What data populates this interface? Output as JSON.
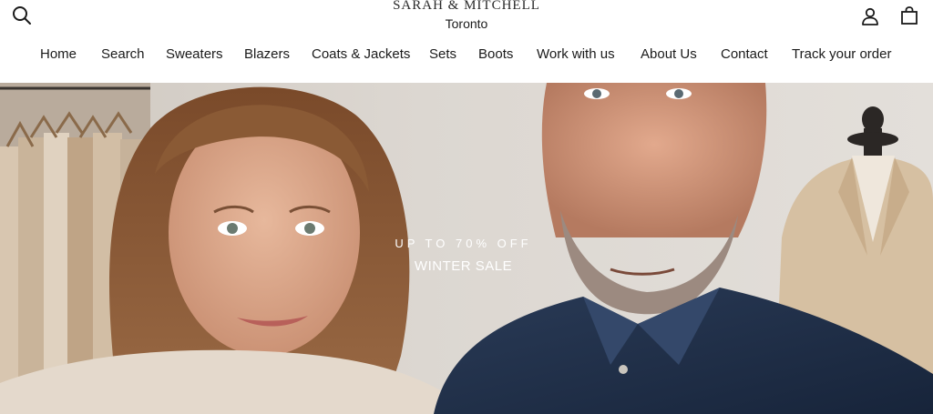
{
  "brand": {
    "name": "SARAH & MITCHELL",
    "location": "Toronto"
  },
  "header": {
    "icons": {
      "search": "search-icon",
      "account": "user-icon",
      "cart": "shopping-bag-icon"
    }
  },
  "nav": {
    "items": [
      {
        "label": "Home"
      },
      {
        "label": "Search"
      },
      {
        "label": "Sweaters"
      },
      {
        "label": "Blazers"
      },
      {
        "label": "Coats & Jackets"
      },
      {
        "label": "Sets"
      },
      {
        "label": "Boots"
      },
      {
        "label": "Work with us"
      },
      {
        "label": "About Us"
      },
      {
        "label": "Contact"
      },
      {
        "label": "Track your order"
      }
    ]
  },
  "hero": {
    "eyebrow": "UP TO 70% OFF",
    "headline": "WINTER SALE"
  }
}
